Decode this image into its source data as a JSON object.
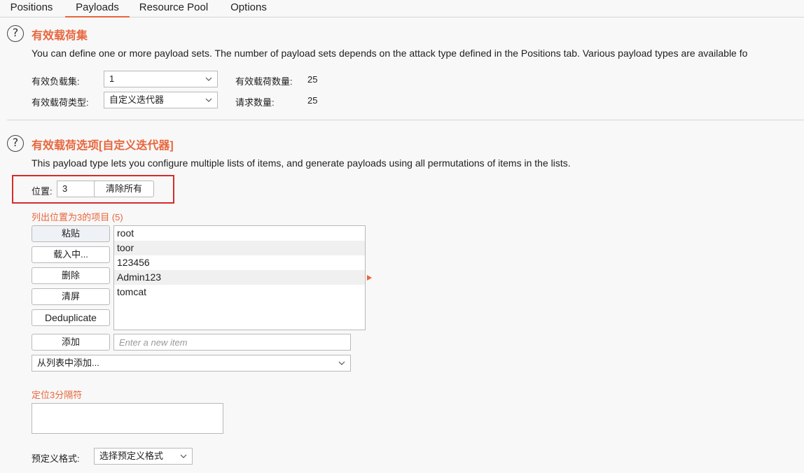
{
  "tabs": [
    {
      "label": "Positions"
    },
    {
      "label": "Payloads"
    },
    {
      "label": "Resource Pool"
    },
    {
      "label": "Options"
    }
  ],
  "payload_sets": {
    "title": "有效载荷集",
    "description": "You can define one or more payload sets. The number of payload sets depends on the attack type defined in the Positions tab. Various payload types are available fo",
    "set_label": "有效负载集:",
    "set_value": "1",
    "type_label": "有效载荷类型:",
    "type_value": "自定义迭代器",
    "count_label": "有效载荷数量:",
    "count_value": "25",
    "requests_label": "请求数量:",
    "requests_value": "25"
  },
  "payload_options": {
    "title": "有效载荷选项[自定义迭代器]",
    "description": "This payload type lets you configure multiple lists of items, and generate payloads using all permutations of items in the lists.",
    "position_label": "位置:",
    "position_value": "3",
    "clear_all_label": "清除所有",
    "list_title": "列出位置为3的项目 (5)",
    "buttons": {
      "paste": "粘贴",
      "load": "载入中...",
      "remove": "删除",
      "clear": "清屏",
      "dedupe": "Deduplicate",
      "add": "添加"
    },
    "items": [
      "root",
      "toor",
      "123456",
      "Admin123",
      "tomcat"
    ],
    "new_item_placeholder": "Enter a new item",
    "add_from_list": "从列表中添加...",
    "separator_title": "定位3分隔符",
    "predefined_label": "预定义格式:",
    "predefined_value": "选择预定义格式"
  },
  "colors": {
    "accent": "#e8663d",
    "highlight_box": "#d62b2b"
  }
}
